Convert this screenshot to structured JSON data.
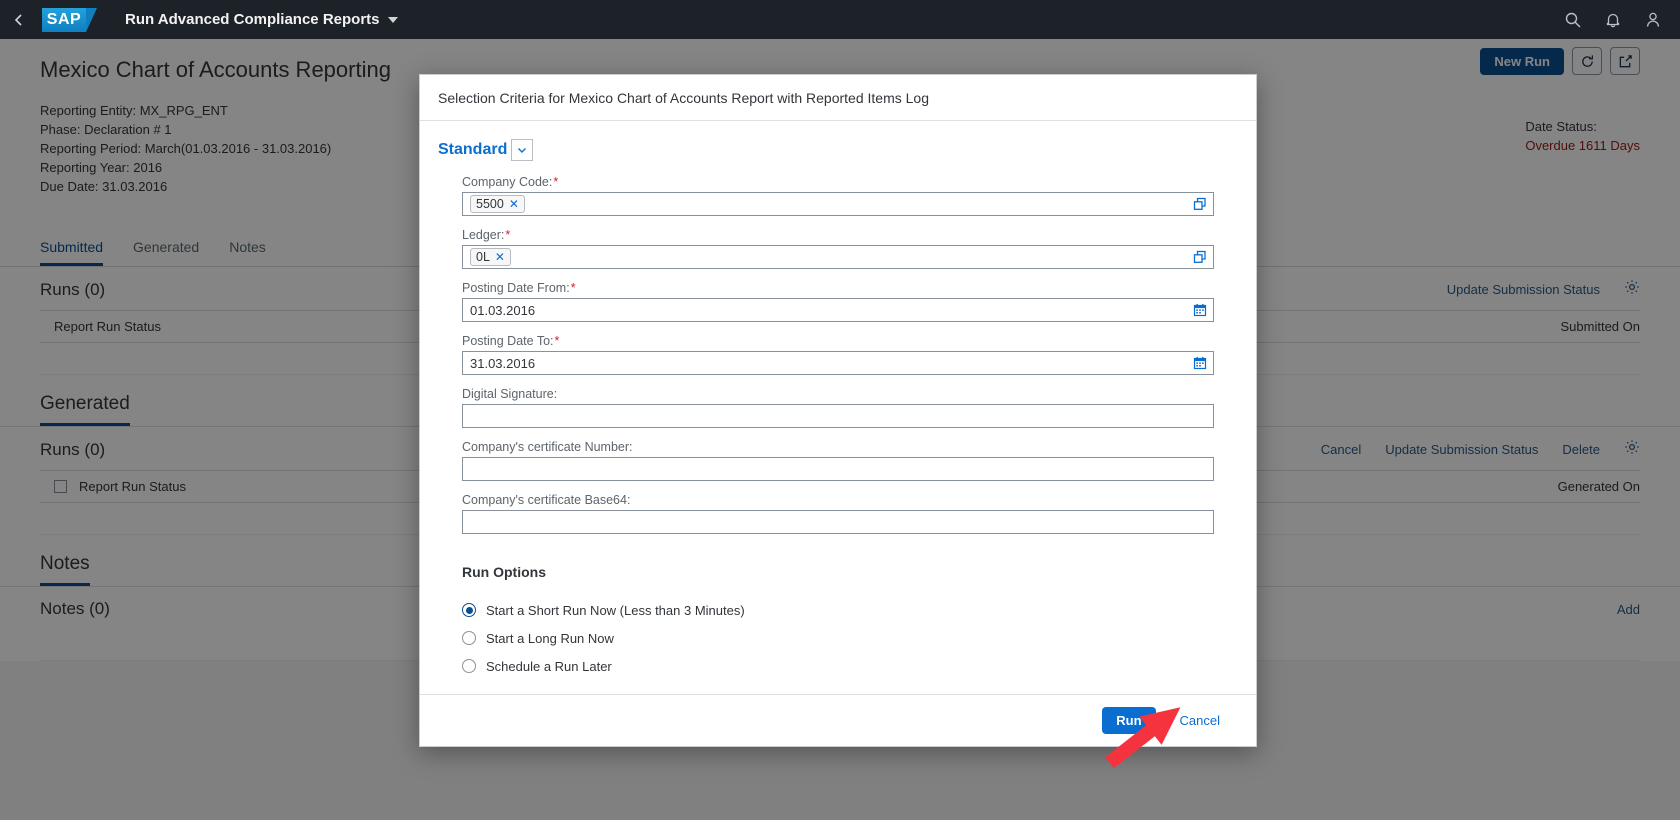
{
  "shellbar": {
    "back_icon": "chevron-left-icon",
    "logo_text": "SAP",
    "app_title": "Run Advanced Compliance Reports",
    "icons": [
      "search-icon",
      "bell-icon",
      "user-icon"
    ]
  },
  "object_header": {
    "title": "Mexico Chart of Accounts Reporting",
    "facts": [
      "Reporting Entity: MX_RPG_ENT",
      "Phase: Declaration # 1",
      "Reporting Period: March(01.03.2016 - 31.03.2016)",
      "Reporting Year: 2016",
      "Due Date: 31.03.2016"
    ],
    "status_label": "Date Status:",
    "status_value": "Overdue 1611 Days",
    "status_color": "#a01b1b",
    "actions": {
      "new_run_label": "New Run",
      "refresh_icon": "refresh-icon",
      "share_icon": "share-icon"
    }
  },
  "tabs": [
    {
      "label": "Submitted",
      "active": true
    },
    {
      "label": "Generated",
      "active": false
    },
    {
      "label": "Notes",
      "active": false
    }
  ],
  "sections": {
    "submitted": {
      "table_title": "Runs (0)",
      "column_header": "Report Run Status",
      "column_header_right": "Submitted On",
      "toolbar_links": [
        "Update Submission Status"
      ],
      "settings_icon": "gear-icon"
    },
    "generated": {
      "heading": "Generated",
      "table_title": "Runs (0)",
      "column_header": "Report Run Status",
      "column_header_right": "Generated On",
      "toolbar_links": [
        "Cancel",
        "Update Submission Status",
        "Delete"
      ],
      "settings_icon": "gear-icon",
      "select_all_checkbox": "select-all-checkbox"
    },
    "notes": {
      "heading": "Notes",
      "table_title": "Notes (0)",
      "add_link": "Add"
    }
  },
  "dialog": {
    "title": "Selection Criteria for Mexico Chart of Accounts Report with Reported Items Log",
    "variant": {
      "name": "Standard",
      "caret_icon": "chevron-down-icon"
    },
    "fields": [
      {
        "label": "Company Code:",
        "required": true,
        "type": "tokenizer",
        "token": "5500",
        "token_remove_icon": "close-icon",
        "end_icon": "value-help-icon"
      },
      {
        "label": "Ledger:",
        "required": true,
        "type": "tokenizer",
        "token": "0L",
        "token_remove_icon": "close-icon",
        "end_icon": "value-help-icon"
      },
      {
        "label": "Posting Date From:",
        "required": true,
        "type": "date",
        "value": "01.03.2016",
        "end_icon": "calendar-icon"
      },
      {
        "label": "Posting Date To:",
        "required": true,
        "type": "date",
        "value": "31.03.2016",
        "end_icon": "calendar-icon"
      },
      {
        "label": "Digital Signature:",
        "required": false,
        "type": "text",
        "value": ""
      },
      {
        "label": "Company's certificate Number:",
        "required": false,
        "type": "text",
        "value": ""
      },
      {
        "label": "Company's certificate Base64:",
        "required": false,
        "type": "text",
        "value": ""
      }
    ],
    "run_options": {
      "title": "Run Options",
      "options": [
        {
          "label": "Start a Short Run Now (Less than 3 Minutes)",
          "selected": true
        },
        {
          "label": "Start a Long Run Now",
          "selected": false
        },
        {
          "label": "Schedule a Run Later",
          "selected": false
        }
      ]
    },
    "footer": {
      "run_label": "Run",
      "cancel_label": "Cancel"
    }
  },
  "annotation": {
    "arrow_color": "#f5333f",
    "points_at": "Run"
  }
}
